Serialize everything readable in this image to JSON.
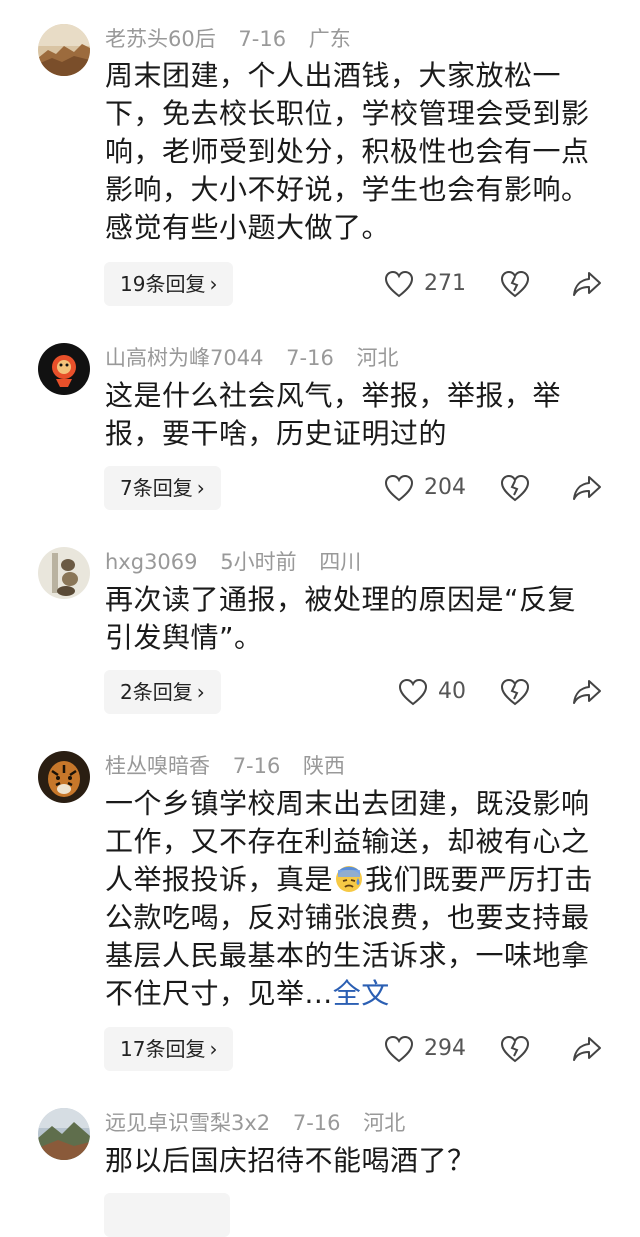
{
  "comments": [
    {
      "username": "老苏头60后",
      "time": "7-16",
      "location": "广东",
      "text": "周末团建，个人出酒钱，大家放松一下，免去校长职位，学校管理会受到影响，老师受到处分，积极性也会有一点影响，大小不好说，学生也会有影响。感觉有些小题大做了。",
      "replies": "19条回复",
      "likes": "271",
      "avatar_color": "#c49a6c"
    },
    {
      "username": "山高树为峰7044",
      "time": "7-16",
      "location": "河北",
      "text": "这是什么社会风气，举报，举报，举报，要干啥，历史证明过的",
      "replies": "7条回复",
      "likes": "204",
      "avatar_color": "#111111"
    },
    {
      "username": "hxg3069",
      "time": "5小时前",
      "location": "四川",
      "text": "再次读了通报，被处理的原因是“反复引发舆情”。",
      "replies": "2条回复",
      "likes": "40",
      "avatar_color": "#d8d4c8"
    },
    {
      "username": "桂丛嗅暗香",
      "time": "7-16",
      "location": "陕西",
      "text_before_emoji": "一个乡镇学校周末出去团建，既没影响工作，又不存在利益输送，却被有心之人举报投诉，真是",
      "text_after_emoji": "我们既要严厉打击公款吃喝，反对铺张浪费，也要支持最基层人民最基本的生活诉求，一味地拿不住尺寸，见举...",
      "full_text_link": "全文",
      "replies": "17条回复",
      "likes": "294",
      "avatar_color": "#3a2a1a"
    },
    {
      "username": "远见卓识雪梨3x2",
      "time": "7-16",
      "location": "河北",
      "text": "那以后国庆招待不能喝酒了？",
      "avatar_color": "#6a7a5a"
    }
  ],
  "icons": {
    "like": "heart-outline-icon",
    "dislike": "broken-heart-icon",
    "share": "share-arrow-icon",
    "chevron": "›"
  }
}
